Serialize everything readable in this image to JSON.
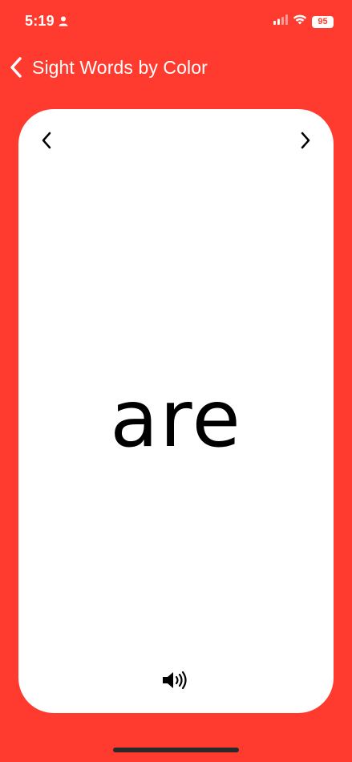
{
  "status_bar": {
    "time": "5:19",
    "battery": "95",
    "icons": [
      "person-icon",
      "cellular-signal-icon",
      "wifi-icon",
      "battery-icon"
    ]
  },
  "nav": {
    "back_icon": "chevron-left-icon",
    "title": "Sight Words by Color"
  },
  "card": {
    "word": "are",
    "prev_icon": "chevron-left-icon",
    "next_icon": "chevron-right-icon",
    "speaker_icon": "speaker-icon"
  },
  "colors": {
    "background": "#FF3B30",
    "card": "#FFFFFF",
    "text": "#000000"
  }
}
